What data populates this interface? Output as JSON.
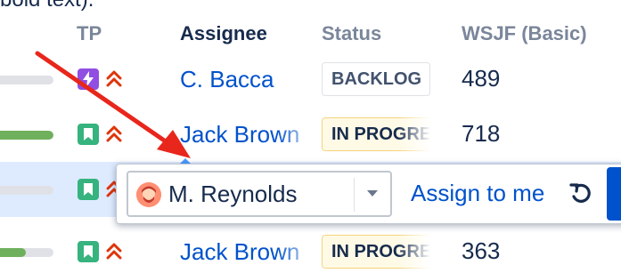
{
  "intro_text": "bold text).",
  "header": {
    "tp": "TP",
    "assignee": "Assignee",
    "status": "Status",
    "wsjf": "WSJF (Basic)"
  },
  "rows": [
    {
      "progress": 0.0,
      "type_icon": "lightning-icon",
      "type_color": "#904ee2",
      "priority_icon": "double-chevron-up-icon",
      "assignee": "C. Bacca",
      "status": "BACKLOG",
      "wsjf": "489"
    },
    {
      "progress": 1.0,
      "type_icon": "bookmark-icon",
      "type_color": "#36b37e",
      "priority_icon": "double-chevron-up-icon",
      "assignee": "Jack Brown",
      "status": "IN PROGRESS",
      "wsjf": "718"
    },
    {
      "progress": 0.0,
      "type_icon": "bookmark-icon",
      "type_color": "#36b37e",
      "priority_icon": "double-chevron-up-icon",
      "assignee": "",
      "status": "",
      "wsjf": ""
    },
    {
      "progress": 0.55,
      "type_icon": "bookmark-icon",
      "type_color": "#36b37e",
      "priority_icon": "double-chevron-up-icon",
      "assignee": "Jack Brown",
      "status": "IN PROGRESS",
      "wsjf": "363"
    }
  ],
  "assignee_editor": {
    "selected_value": "M. Reynolds",
    "assign_to_me_label": "Assign to me",
    "undo_icon": "undo-icon",
    "dropdown_icon": "chevron-down-icon"
  },
  "colors": {
    "link": "#0052cc",
    "annotation_arrow": "#e8261c",
    "highlight_row": "#deebff"
  }
}
